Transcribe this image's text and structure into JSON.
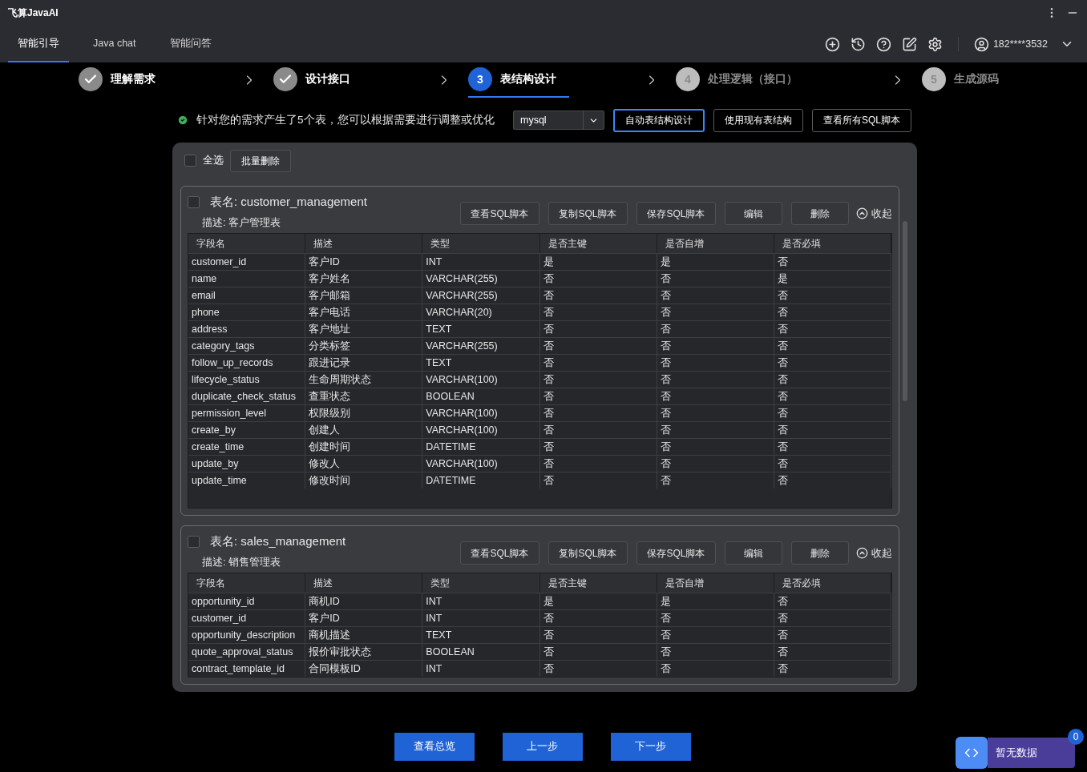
{
  "app_title": "飞算JavaAI",
  "tabs": [
    {
      "label": "智能引导",
      "selected": true
    },
    {
      "label": "Java chat",
      "selected": false
    },
    {
      "label": "智能问答",
      "selected": false
    }
  ],
  "user": {
    "phone": "182****3532"
  },
  "steps": [
    {
      "label": "理解需求",
      "kind": "done",
      "selected": false
    },
    {
      "label": "设计接口",
      "kind": "done",
      "selected": false
    },
    {
      "number": "3",
      "label": "表结构设计",
      "kind": "todo",
      "selected": true
    },
    {
      "number": "4",
      "label": "处理逻辑（接口）",
      "kind": "todo",
      "selected": false
    },
    {
      "number": "5",
      "label": "生成源码",
      "kind": "todo",
      "selected": false
    }
  ],
  "message": "针对您的需求产生了5个表，您可以根据需要进行调整或优化",
  "db_select": {
    "value": "mysql"
  },
  "actions": [
    {
      "label": "自动表结构设计",
      "selected": true
    },
    {
      "label": "使用现有表结构",
      "selected": false
    },
    {
      "label": "查看所有SQL脚本",
      "selected": false
    }
  ],
  "select_all": {
    "label": "全选",
    "checked": false
  },
  "batch_delete": "批量删除",
  "tables": [
    {
      "name": "表名: customer_management",
      "description": "描述: 客户管理表",
      "checked": false,
      "buttons": [
        "查看SQL脚本",
        "复制SQL脚本",
        "保存SQL脚本",
        "编辑",
        "删除"
      ],
      "collapse": "收起",
      "columns": [
        "字段名",
        "描述",
        "类型",
        "是否主键",
        "是否自增",
        "是否必填"
      ],
      "rows": [
        [
          "customer_id",
          "客户ID",
          "INT",
          "是",
          "是",
          "否"
        ],
        [
          "name",
          "客户姓名",
          "VARCHAR(255)",
          "否",
          "否",
          "是"
        ],
        [
          "email",
          "客户邮箱",
          "VARCHAR(255)",
          "否",
          "否",
          "否"
        ],
        [
          "phone",
          "客户电话",
          "VARCHAR(20)",
          "否",
          "否",
          "否"
        ],
        [
          "address",
          "客户地址",
          "TEXT",
          "否",
          "否",
          "否"
        ],
        [
          "category_tags",
          "分类标签",
          "VARCHAR(255)",
          "否",
          "否",
          "否"
        ],
        [
          "follow_up_records",
          "跟进记录",
          "TEXT",
          "否",
          "否",
          "否"
        ],
        [
          "lifecycle_status",
          "生命周期状态",
          "VARCHAR(100)",
          "否",
          "否",
          "否"
        ],
        [
          "duplicate_check_status",
          "查重状态",
          "BOOLEAN",
          "否",
          "否",
          "否"
        ],
        [
          "permission_level",
          "权限级别",
          "VARCHAR(100)",
          "否",
          "否",
          "否"
        ],
        [
          "create_by",
          "创建人",
          "VARCHAR(100)",
          "否",
          "否",
          "否"
        ],
        [
          "create_time",
          "创建时间",
          "DATETIME",
          "否",
          "否",
          "否"
        ],
        [
          "update_by",
          "修改人",
          "VARCHAR(100)",
          "否",
          "否",
          "否"
        ],
        [
          "update_time",
          "修改时间",
          "DATETIME",
          "否",
          "否",
          "否"
        ]
      ]
    },
    {
      "name": "表名: sales_management",
      "description": "描述: 销售管理表",
      "checked": false,
      "buttons": [
        "查看SQL脚本",
        "复制SQL脚本",
        "保存SQL脚本",
        "编辑",
        "删除"
      ],
      "collapse": "收起",
      "columns": [
        "字段名",
        "描述",
        "类型",
        "是否主键",
        "是否自增",
        "是否必填"
      ],
      "rows": [
        [
          "opportunity_id",
          "商机ID",
          "INT",
          "是",
          "是",
          "否"
        ],
        [
          "customer_id",
          "客户ID",
          "INT",
          "否",
          "否",
          "否"
        ],
        [
          "opportunity_description",
          "商机描述",
          "TEXT",
          "否",
          "否",
          "否"
        ],
        [
          "quote_approval_status",
          "报价审批状态",
          "BOOLEAN",
          "否",
          "否",
          "否"
        ],
        [
          "contract_template_id",
          "合同模板ID",
          "INT",
          "否",
          "否",
          "否"
        ]
      ]
    }
  ],
  "footer_buttons": [
    "查看总览",
    "上一步",
    "下一步"
  ],
  "widget": {
    "label": "暂无数据",
    "badge": "0"
  }
}
